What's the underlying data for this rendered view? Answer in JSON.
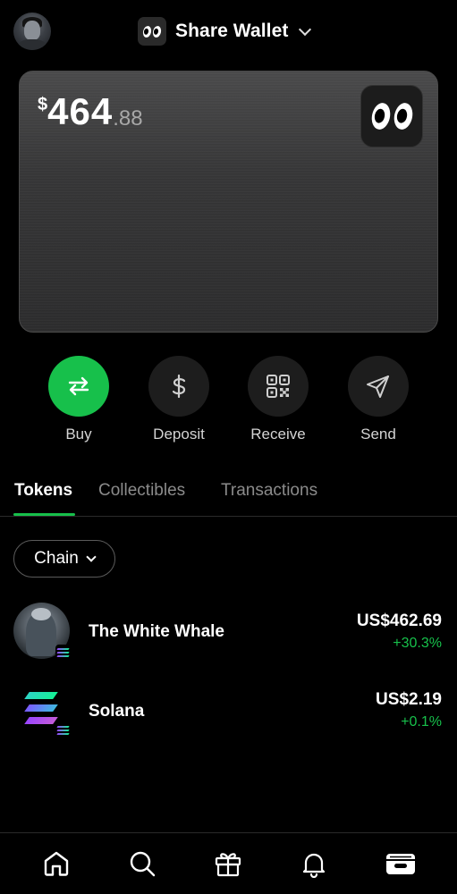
{
  "header": {
    "wallet_name": "Share Wallet"
  },
  "card": {
    "currency_symbol": "$",
    "balance_int": "464",
    "balance_dec": ".88"
  },
  "actions": [
    {
      "label": "Buy",
      "icon": "swap-arrows-icon"
    },
    {
      "label": "Deposit",
      "icon": "dollar-icon"
    },
    {
      "label": "Receive",
      "icon": "qr-code-icon"
    },
    {
      "label": "Send",
      "icon": "paper-plane-icon"
    }
  ],
  "tabs": [
    {
      "label": "Tokens",
      "active": true
    },
    {
      "label": "Collectibles",
      "active": false
    },
    {
      "label": "Transactions",
      "active": false
    }
  ],
  "filter": {
    "chain_label": "Chain"
  },
  "tokens": [
    {
      "name": "The White Whale",
      "value": "US$462.69",
      "change": "+30.3%"
    },
    {
      "name": "Solana",
      "value": "US$2.19",
      "change": "+0.1%"
    }
  ],
  "nav": [
    {
      "icon": "home-icon"
    },
    {
      "icon": "search-icon"
    },
    {
      "icon": "gift-icon"
    },
    {
      "icon": "bell-icon"
    },
    {
      "icon": "wallet-icon"
    }
  ],
  "colors": {
    "accent_green": "#17c04b",
    "background": "#000000"
  }
}
